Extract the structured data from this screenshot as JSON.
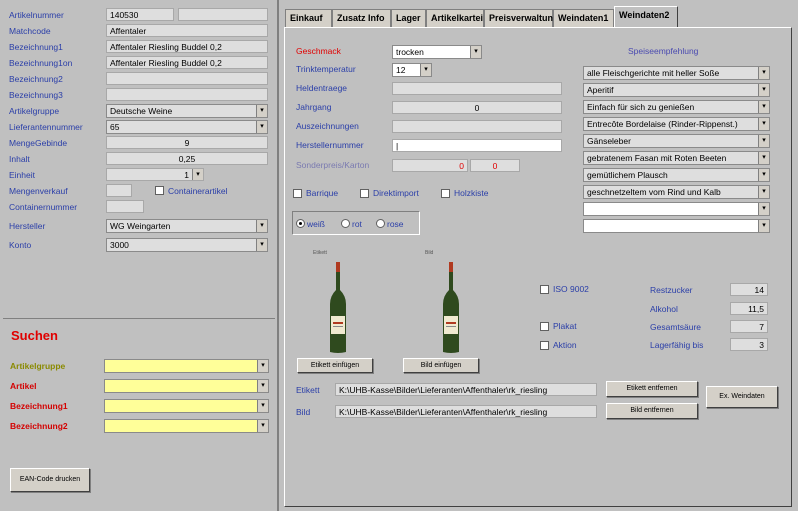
{
  "left": {
    "fields": [
      {
        "label": "Artikelnummer",
        "value": "140530"
      },
      {
        "label": "Matchcode",
        "value": "Affentaler"
      },
      {
        "label": "Bezeichnung1",
        "value": "Affentaler Riesling Buddel 0,2"
      },
      {
        "label": "Bezeichnung1on",
        "value": "Affentaler Riesling Buddel 0,2"
      },
      {
        "label": "Bezeichnung2",
        "value": ""
      },
      {
        "label": "Bezeichnung3",
        "value": ""
      },
      {
        "label": "Artikelgruppe",
        "value": "Deutsche Weine"
      },
      {
        "label": "Lieferantennummer",
        "value": "65"
      },
      {
        "label": "MengeGebinde",
        "value": "9"
      },
      {
        "label": "Inhalt",
        "value": "0,25"
      },
      {
        "label": "Einheit",
        "value": "1"
      },
      {
        "label": "Mengenverkauf",
        "value": ""
      },
      {
        "label": "Containernummer",
        "value": ""
      },
      {
        "label": "Hersteller",
        "value": "WG Weingarten"
      },
      {
        "label": "Konto",
        "value": "3000"
      }
    ],
    "containerartikel_label": "Containerartikel",
    "search": {
      "title": "Suchen",
      "rows": [
        {
          "label": "Artikelgruppe",
          "color": "#8a8a00"
        },
        {
          "label": "Artikel",
          "color": "#d40000"
        },
        {
          "label": "Bezeichnung1",
          "color": "#d40000"
        },
        {
          "label": "Bezeichnung2",
          "color": "#d40000"
        }
      ]
    },
    "ean_button": "EAN-Code drucken"
  },
  "tabs": [
    "Einkauf",
    "Zusatz Info",
    "Lager",
    "Artikelkartei",
    "Preisverwaltung",
    "Weindaten1",
    "Weindaten2"
  ],
  "active_tab": "Weindaten2",
  "wine": {
    "geschmack_label": "Geschmack",
    "geschmack_value": "trocken",
    "trinktemp_label": "Trinktemperatur",
    "trinktemp_value": "12",
    "heldentraege_label": "Heldentraege",
    "jahrgang_label": "Jahrgang",
    "jahrgang_value": "0",
    "auszeichnungen_label": "Auszeichnungen",
    "herstellernummer_label": "Herstellernummer",
    "sonderpreis_label": "Sonderpreis/Karton",
    "sonderpreis_value1": "0",
    "sonderpreis_value2": "0",
    "checks": [
      "Barrique",
      "Direktimport",
      "Holzkiste"
    ],
    "colors": [
      "weiß",
      "rot",
      "rose"
    ],
    "etikett_label": "Etikett",
    "bild_label": "Bild",
    "etikett_button": "Etikett einfügen",
    "bild_button": "Bild einfügen",
    "iso": "ISO 9002",
    "plakat": "Plakat",
    "aktion": "Aktion",
    "stats": [
      {
        "label": "Restzucker",
        "value": "14"
      },
      {
        "label": "Alkohol",
        "value": "11,5"
      },
      {
        "label": "Gesamtsäure",
        "value": "7"
      },
      {
        "label": "Lagerfähig bis",
        "value": "3"
      }
    ],
    "etikett_path": "K:\\UHB-Kasse\\Bilder\\Lieferanten\\Affenthaler\\rk_riesling",
    "bild_path": "K:\\UHB-Kasse\\Bilder\\Lieferanten\\Affenthaler\\rk_riesling",
    "etikett_remove": "Etikett entfernen",
    "bild_remove": "Bild entfernen",
    "ex_button": "Ex. Weindaten"
  },
  "speise": {
    "title": "Speiseempfehlung",
    "items": [
      "alle Fleischgerichte mit heller Soße",
      "Aperitif",
      "Einfach für sich zu genießen",
      "Entrecôte Bordelaise (Rinder-Rippenst.)",
      "Gänseleber",
      "gebratenem Fasan mit Roten Beeten",
      "gemütlichem Plausch",
      "geschnetzeltem vom Rind und Kalb",
      "",
      ""
    ]
  }
}
